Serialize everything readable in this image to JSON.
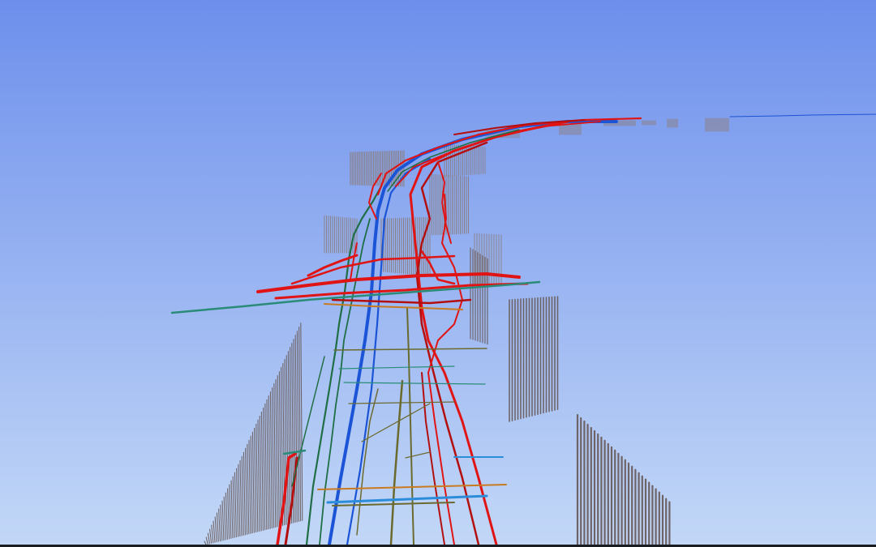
{
  "scene": {
    "kind": "3d-utility-network-view",
    "sky_colors": {
      "top": "#6d8fec",
      "bottom": "#c3d8f7"
    },
    "layer_colors": {
      "pipe_red": "#e01414",
      "pipe_dark_red": "#b30f0f",
      "pipe_blue": "#1b54d6",
      "pipe_green": "#1f6e45",
      "pipe_teal": "#2a8c78",
      "pipe_olive": "#6b6a2e",
      "pipe_orange": "#c87a20",
      "pipe_light_blue": "#2b8cd9",
      "pile_grey": "#8a7f82",
      "pile_grey_dark": "#6e6468"
    },
    "visible_layers": [
      "pipe_red",
      "pipe_blue",
      "pipe_green",
      "pipe_teal",
      "pipe_olive",
      "pipe_orange",
      "pile_grey"
    ]
  }
}
